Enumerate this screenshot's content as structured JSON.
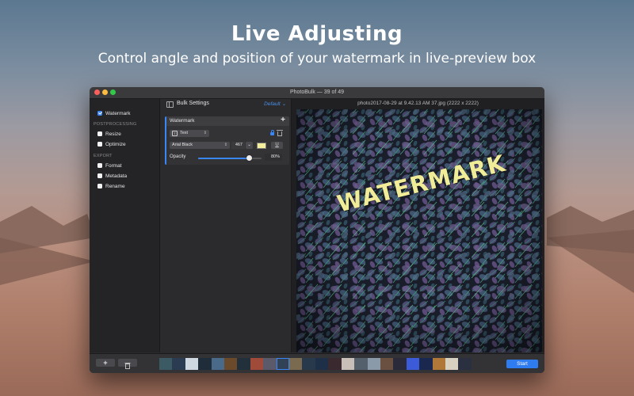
{
  "hero": {
    "title": "Live Adjusting",
    "subtitle": "Control angle and position of your watermark in live-preview box"
  },
  "window": {
    "title": "PhotoBulk — 39 of 49"
  },
  "sidebar": {
    "watermark_label": "Watermark",
    "postprocessing_section": "POSTPROCESSING",
    "resize_label": "Resize",
    "optimize_label": "Optimize",
    "export_section": "EXPORT",
    "format_label": "Format",
    "metadata_label": "Metadata",
    "rename_label": "Rename",
    "watermark_checked": true
  },
  "settings": {
    "title": "Bulk Settings",
    "preset": "Default ⌄",
    "card_title": "Watermark",
    "add_symbol": "+",
    "type_value": "Text",
    "font_value": "Arial Black",
    "font_size": "467",
    "underline_label": "U",
    "text_color": "#f3ef9c",
    "opacity_label": "Opacity",
    "opacity_value": "80%",
    "opacity_level": 0.8
  },
  "preview": {
    "filename": "photo2017-08-29 at 9.42.13 AM 37.jpg (2222 x 2222)",
    "watermark_text": "WATERMARK"
  },
  "bottom": {
    "add_label": "+",
    "delete_icon": "trash-icon",
    "start_label": "Start"
  },
  "filmstrip": {
    "thumbs": [
      "#3c5a64",
      "#2a3b52",
      "#cfd8e0",
      "#1f2d3a",
      "#4a6a8a",
      "#6b4a2c",
      "#22303b",
      "#a04a3a",
      "#5a5a6a",
      "#314256",
      "#7a6a50",
      "#29394c",
      "#1e3048",
      "#3a2a30",
      "#c8c0b8",
      "#54606c",
      "#8a9aa8",
      "#6a5040",
      "#2a2a3a",
      "#3b5bd8",
      "#1a2850",
      "#b07838",
      "#d8d0c0",
      "#2a3040"
    ]
  },
  "colors": {
    "accent": "#3b86f7",
    "start_button": "#2f7bf0"
  }
}
